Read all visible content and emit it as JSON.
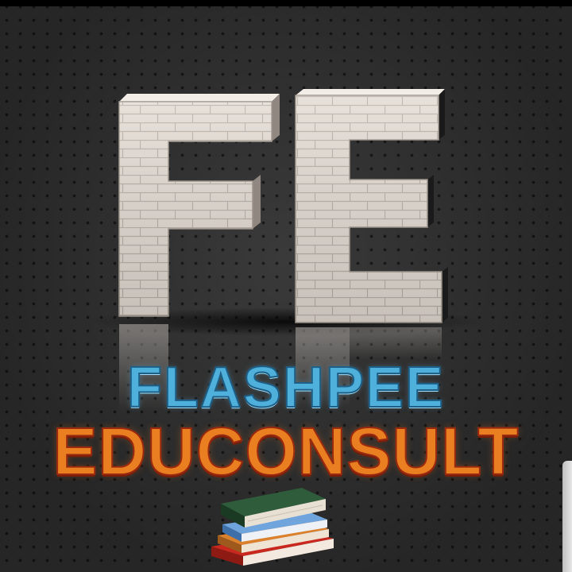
{
  "logo": {
    "monogram": "FE",
    "brand_line_1": "FLASHPEE",
    "brand_line_2": "EDUCONSULT",
    "icon": "books-stack-icon"
  },
  "colors": {
    "background": "#2b2b2b",
    "brick_light": "#e2dbd3",
    "brand_line_1": "#4fb0dc",
    "brand_line_2": "#e97f21",
    "brand_line_2_edge": "#c0321a"
  }
}
